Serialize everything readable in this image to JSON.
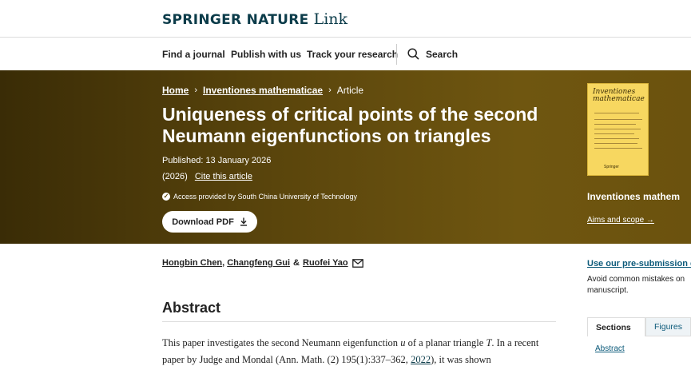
{
  "header": {
    "brand": "SPRINGER NATURE",
    "link": "Link"
  },
  "nav": {
    "items": [
      "Find a journal",
      "Publish with us",
      "Track your research"
    ],
    "search_label": "Search"
  },
  "breadcrumb": {
    "home": "Home",
    "journal": "Inventiones mathematicae",
    "current": "Article"
  },
  "article": {
    "title": "Uniqueness of critical points of the second Neumann eigenfunctions on triangles",
    "published": "Published: 13 January 2026",
    "year": "(2026)",
    "cite": "Cite this article",
    "access": "Access provided by South China University of Technology",
    "download": "Download PDF",
    "authors": [
      "Hongbin Chen",
      "Changfeng Gui",
      "Ruofei Yao"
    ],
    "author_sep_1": ",",
    "author_sep_2": "&"
  },
  "journal_side": {
    "cover_title": "Inventiones mathematicae",
    "cover_publisher": "Springer",
    "name": "Inventiones mathem",
    "aims": "Aims and scope →"
  },
  "abstract": {
    "heading": "Abstract",
    "text_1": "This paper investigates the second Neumann eigenfunction ",
    "var_u": "u",
    "text_2": " of a planar triangle ",
    "var_T": "T",
    "text_3": ". In a recent paper by Judge and Mondal (Ann. Math. (2) 195(1):337–362, ",
    "ref": "2022",
    "text_4": "), it was shown"
  },
  "sidebar": {
    "presub_link": "Use our pre-submission ch",
    "presub_desc": "Avoid common mistakes on manuscript.",
    "tabs": [
      "Sections",
      "Figures"
    ],
    "section_link": "Abstract"
  }
}
